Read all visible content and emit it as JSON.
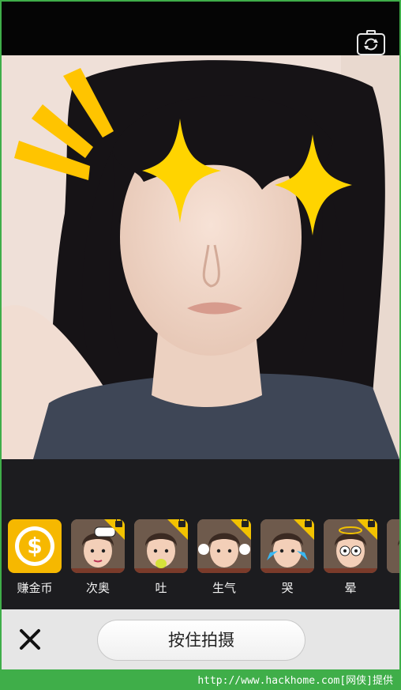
{
  "effects": [
    {
      "label": "赚金币",
      "type": "coin",
      "locked": false,
      "coin_symbol": "$"
    },
    {
      "label": "次奥",
      "type": "face",
      "locked": true,
      "overlay": "text-bubble"
    },
    {
      "label": "吐",
      "type": "face",
      "locked": true,
      "overlay": "vomit"
    },
    {
      "label": "生气",
      "type": "face",
      "locked": true,
      "overlay": "steam"
    },
    {
      "label": "哭",
      "type": "face",
      "locked": true,
      "overlay": "tears"
    },
    {
      "label": "晕",
      "type": "face",
      "locked": true,
      "overlay": "dizzy-eyes"
    },
    {
      "label": "",
      "type": "face-partial",
      "locked": false,
      "overlay": ""
    }
  ],
  "bottom_bar": {
    "close_icon": "close-icon",
    "shoot_label": "按住拍摄"
  },
  "top_bar": {
    "switch_camera_icon": "camera-switch-icon"
  },
  "watermark": "http://www.hackhome.com[网侠]提供",
  "colors": {
    "accent": "#f6b800",
    "lock_corner": "#f2c200",
    "sparkle": "#ffd400"
  }
}
